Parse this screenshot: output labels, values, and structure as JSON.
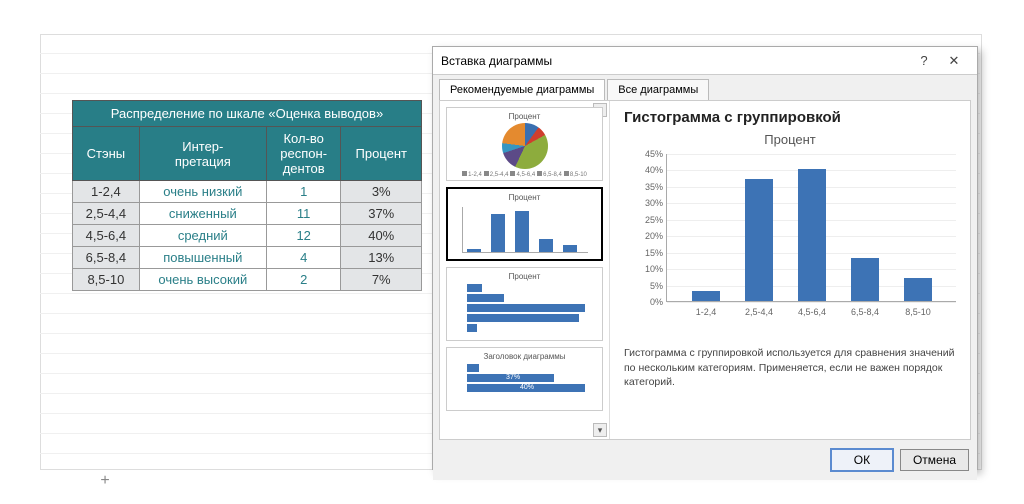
{
  "dialog": {
    "title": "Вставка диаграммы",
    "tabs": [
      "Рекомендуемые диаграммы",
      "Все диаграммы"
    ],
    "active_tab": 0,
    "preview_heading": "Гистограмма с группировкой",
    "preview_chart_title": "Процент",
    "description": "Гистограмма с группировкой используется для сравнения значений по нескольким категориям. Применяется, если не важен порядок категорий.",
    "ok_label": "ОК",
    "cancel_label": "Отмена",
    "help_label": "?",
    "close_label": "✕",
    "thumbs": [
      {
        "type": "pie",
        "title": "Процент"
      },
      {
        "type": "column",
        "title": "Процент"
      },
      {
        "type": "bar_h",
        "title": "Процент"
      },
      {
        "type": "bar_h2",
        "title": "Заголовок диаграммы"
      }
    ]
  },
  "table": {
    "title": "Распределение по шкале «Оценка выводов»",
    "headers": [
      "Стэны",
      "Интер-\nпретация",
      "Кол-во\nреспон-\nдентов",
      "Процент"
    ],
    "rows": [
      {
        "range": "1-2,4",
        "interp": "очень низкий",
        "count": "1",
        "pct": "3%"
      },
      {
        "range": "2,5-4,4",
        "interp": "сниженный",
        "count": "11",
        "pct": "37%"
      },
      {
        "range": "4,5-6,4",
        "interp": "средний",
        "count": "12",
        "pct": "40%"
      },
      {
        "range": "6,5-8,4",
        "interp": "повышенный",
        "count": "4",
        "pct": "13%"
      },
      {
        "range": "8,5-10",
        "interp": "очень высокий",
        "count": "2",
        "pct": "7%"
      }
    ]
  },
  "chart_data": {
    "type": "bar",
    "title": "Процент",
    "xlabel": "",
    "ylabel": "",
    "categories": [
      "1-2,4",
      "2,5-4,4",
      "4,5-6,4",
      "6,5-8,4",
      "8,5-10"
    ],
    "values": [
      3,
      37,
      40,
      13,
      7
    ],
    "ylim": [
      0,
      45
    ],
    "yticks": [
      0,
      5,
      10,
      15,
      20,
      25,
      30,
      35,
      40,
      45
    ]
  },
  "sheet_tab_plus": "+"
}
